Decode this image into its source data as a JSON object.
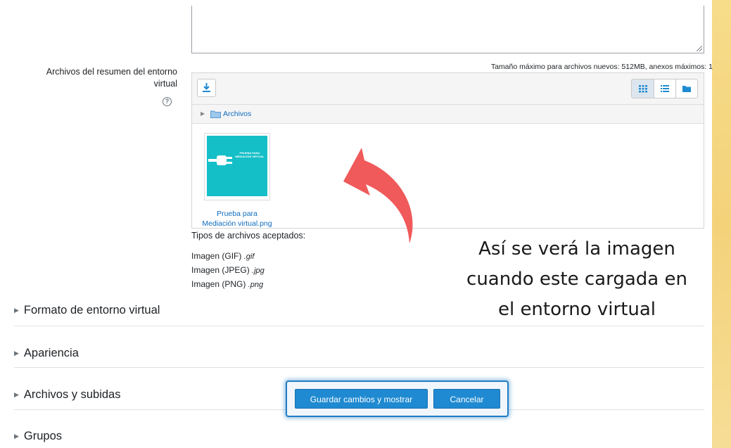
{
  "field": {
    "label": "Archivos del resumen del entorno virtual",
    "help_icon": "question-circle-icon"
  },
  "filemanager": {
    "max_size_text": "Tamaño máximo para archivos nuevos: 512MB, anexos máximos: 1",
    "add_icon": "download-icon",
    "views": [
      "grid-view-icon",
      "list-view-icon",
      "folder-view-icon"
    ],
    "path_label": "Archivos",
    "file": {
      "name_line1": "Prueba para",
      "name_line2": "Mediación virtual.png",
      "thumb_text": "PRUEBA PARA MEDIACIÓN VIRTUAL",
      "thumb_color": "#14bfc7"
    }
  },
  "accepted": {
    "title": "Tipos de archivos aceptados:",
    "types": [
      {
        "label": "Imagen (GIF)",
        "ext": ".gif"
      },
      {
        "label": "Imagen (JPEG)",
        "ext": ".jpg"
      },
      {
        "label": "Imagen (PNG)",
        "ext": ".png"
      }
    ]
  },
  "sections": [
    "Formato de entorno virtual",
    "Apariencia",
    "Archivos y subidas",
    "Grupos"
  ],
  "annotation": {
    "line1": "Así se verá la imagen",
    "line2": "cuando este cargada en",
    "line3": "el entorno virtual",
    "arrow_color": "#f05a5a"
  },
  "buttons": {
    "save": "Guardar cambios y mostrar",
    "cancel": "Cancelar",
    "color": "#1f8ad1"
  }
}
